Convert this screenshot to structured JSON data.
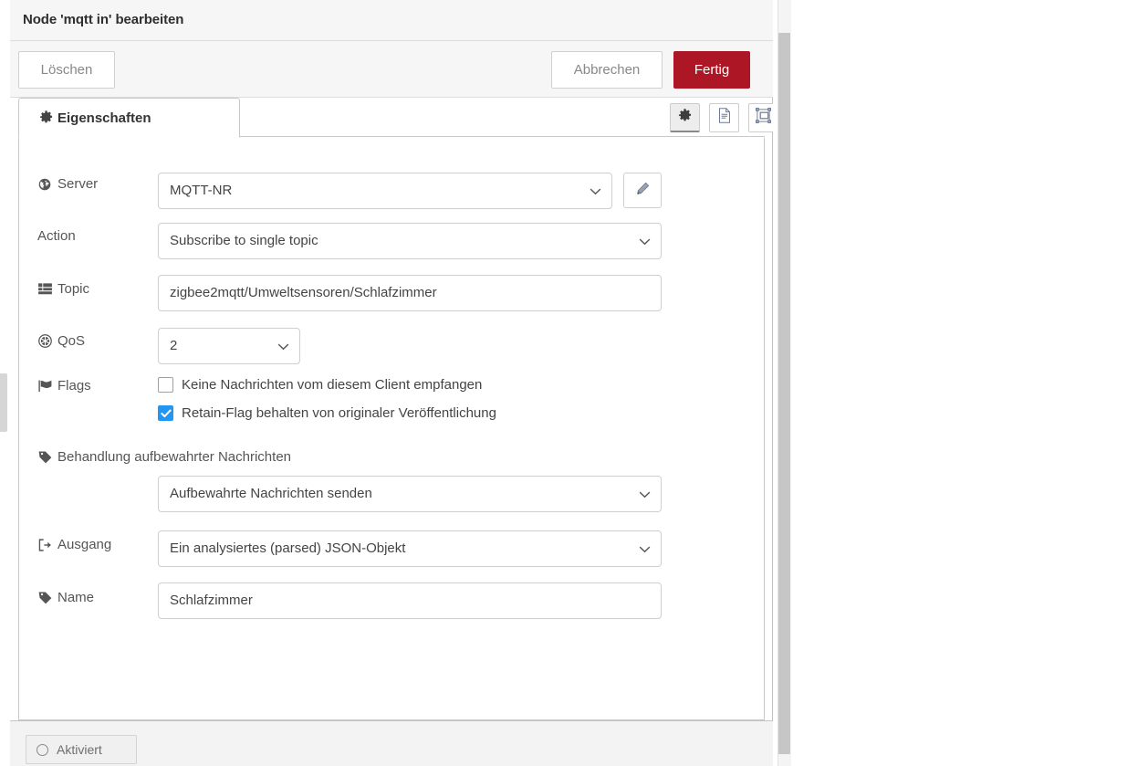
{
  "dialog": {
    "title": "Node 'mqtt in' bearbeiten"
  },
  "actions": {
    "delete_label": "Löschen",
    "cancel_label": "Abbrechen",
    "done_label": "Fertig",
    "done_color": "#ad1625"
  },
  "tabs": {
    "properties_label": "Eigenschaften",
    "icons": [
      {
        "name": "gear-icon",
        "active": true
      },
      {
        "name": "description-icon",
        "active": false
      },
      {
        "name": "appearance-icon",
        "active": false
      }
    ]
  },
  "form": {
    "server": {
      "label": "Server",
      "icon": "globe-icon",
      "value": "MQTT-NR",
      "edit_icon": "pencil-icon"
    },
    "action": {
      "label": "Action",
      "value": "Subscribe to single topic"
    },
    "topic": {
      "label": "Topic",
      "icon": "tasks-icon",
      "value": "zigbee2mqtt/Umweltsensoren/Schlafzimmer"
    },
    "qos": {
      "label": "QoS",
      "icon": "qos-icon",
      "value": "2"
    },
    "flags": {
      "label": "Flags",
      "icon": "flag-icon",
      "items": [
        {
          "label": "Keine Nachrichten vom diesem Client empfangen",
          "checked": false
        },
        {
          "label": "Retain-Flag behalten von originaler Veröffentlichung",
          "checked": true
        }
      ],
      "checked_color": "#2196f3"
    },
    "retained_handling": {
      "label": "Behandlung aufbewahrter Nachrichten",
      "icon": "tag-icon",
      "value": "Aufbewahrte Nachrichten senden"
    },
    "output": {
      "label": "Ausgang",
      "icon": "sign-out-icon",
      "value": "Ein analysiertes (parsed) JSON-Objekt"
    },
    "name": {
      "label": "Name",
      "icon": "tag-icon",
      "value": "Schlafzimmer"
    }
  },
  "footer": {
    "enabled_label": "Aktiviert",
    "enabled_icon": "circle-icon"
  }
}
